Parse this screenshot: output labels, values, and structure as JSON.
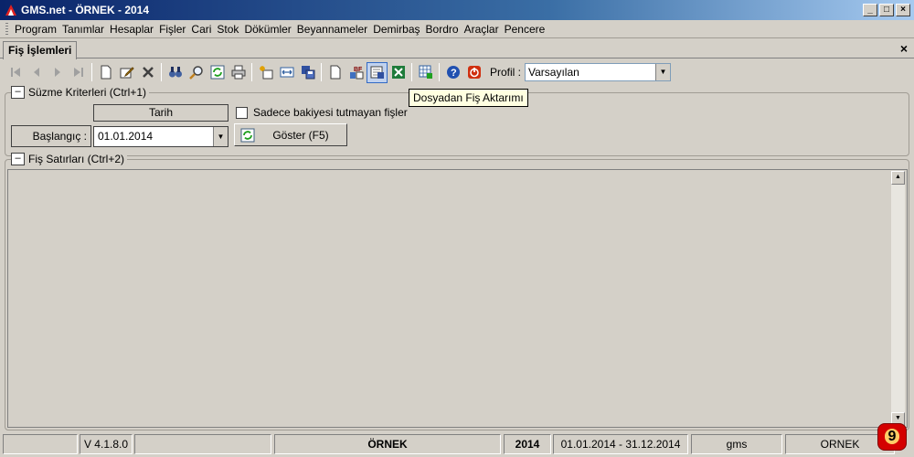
{
  "window": {
    "title": "GMS.net - ÖRNEK - 2014"
  },
  "menu": [
    "Program",
    "Tanımlar",
    "Hesaplar",
    "Fişler",
    "Cari",
    "Stok",
    "Dökümler",
    "Beyannameler",
    "Demirbaş",
    "Bordro",
    "Araçlar",
    "Pencere"
  ],
  "tab": {
    "label": "Fiş İşlemleri",
    "close": "×"
  },
  "toolbar": {
    "profile_label": "Profil :",
    "profile_value": "Varsayılan",
    "tooltip": "Dosyadan Fiş Aktarımı",
    "buttons": [
      "first-icon",
      "prev-icon",
      "next-icon",
      "last-icon",
      "new-doc-icon",
      "edit-icon",
      "delete-icon",
      "binoculars-icon",
      "search-icon",
      "refresh-icon",
      "print-icon",
      "new-item-icon",
      "resize-icon",
      "save-icon",
      "blank-doc-icon",
      "bf-icon",
      "import-file-icon",
      "excel-icon",
      "grid-export-icon",
      "help-icon",
      "power-icon"
    ]
  },
  "filter": {
    "title": "Süzme Kriterleri (Ctrl+1)",
    "column_header": "Tarih",
    "start_label": "Başlangıç :",
    "start_value": "01.01.2014",
    "checkbox_label": "Sadece bakiyesi tutmayan fişler",
    "show_button": "Göster (F5)"
  },
  "lines": {
    "title": "Fiş Satırları (Ctrl+2)"
  },
  "status": {
    "version": "V 4.1.8.0",
    "company": "ÖRNEK",
    "year": "2014",
    "period": "01.01.2014 - 31.12.2014",
    "user": "gms",
    "company2": "ORNEK",
    "badge": "9"
  },
  "colors": {
    "title_start": "#0a246a",
    "title_end": "#a6caf0",
    "tooltip_bg": "#ffffe1"
  }
}
